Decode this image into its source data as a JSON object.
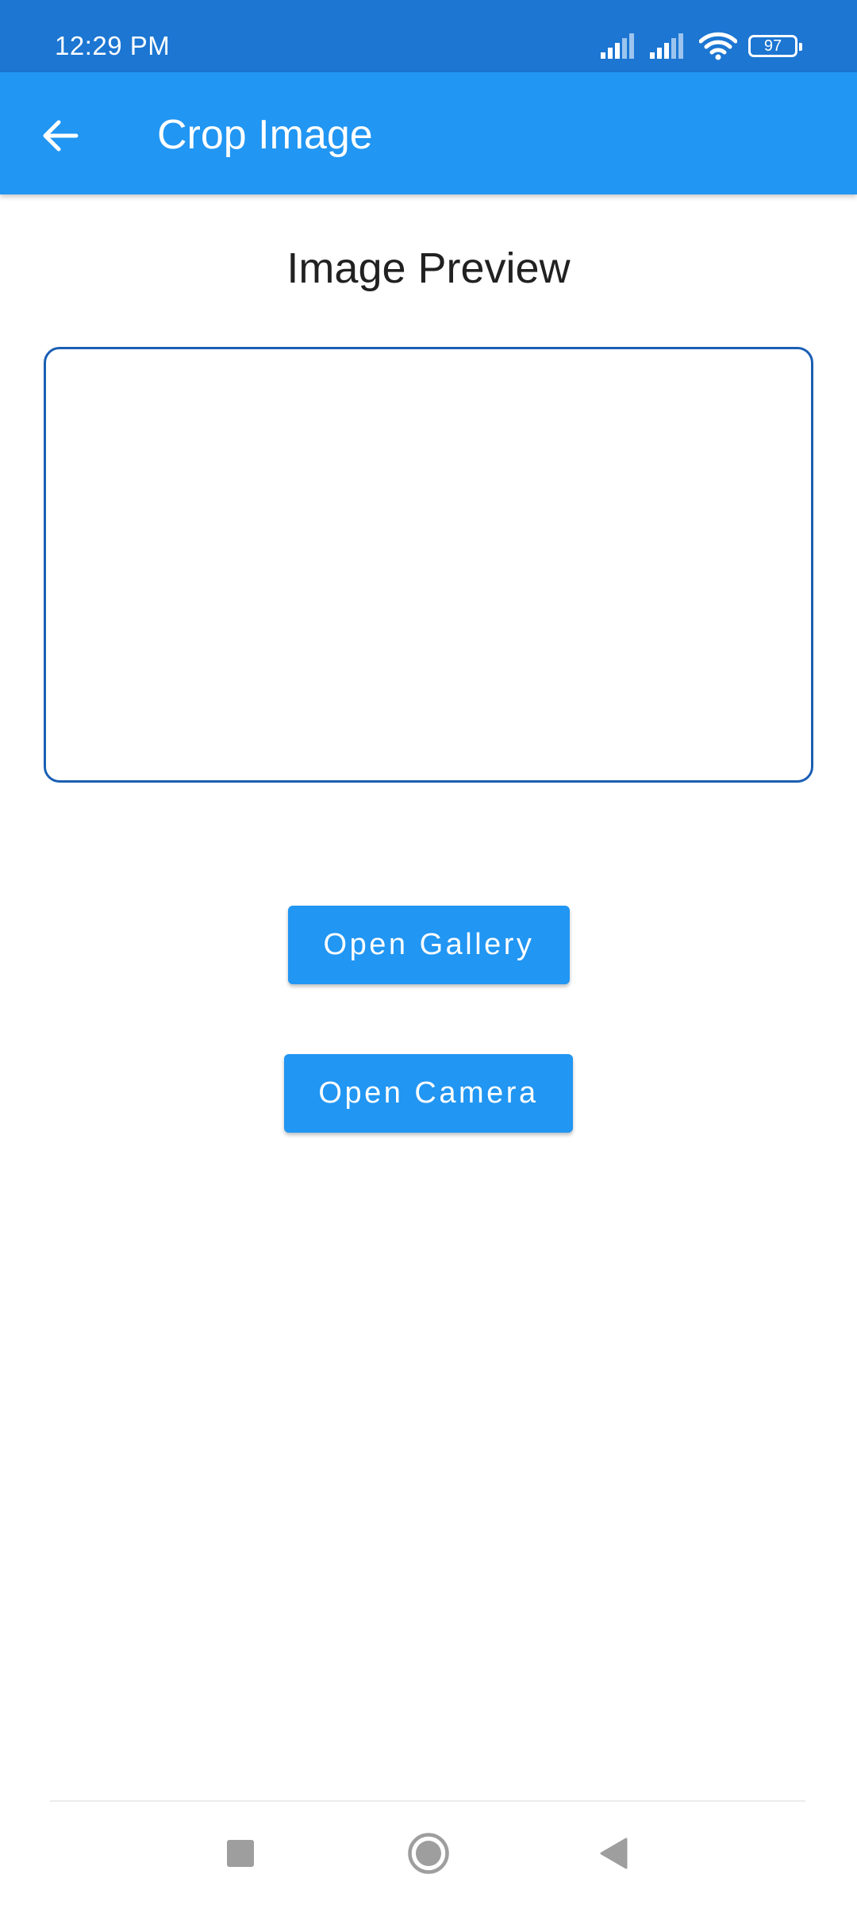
{
  "status_bar": {
    "time": "12:29 PM",
    "battery_level": "97",
    "icons": [
      "signal-icon",
      "signal-icon",
      "wifi-icon",
      "battery-icon"
    ]
  },
  "app_bar": {
    "title": "Crop Image",
    "back_icon": "arrow-back-icon",
    "color": "#2196f3"
  },
  "content": {
    "preview_title": "Image Preview",
    "preview_border_color": "#1a5fb4",
    "buttons": {
      "gallery_label": "Open Gallery",
      "camera_label": "Open Camera",
      "color": "#2196f3"
    }
  },
  "nav_bar": {
    "icons": [
      "recents-square-icon",
      "home-circle-icon",
      "back-triangle-icon"
    ]
  },
  "colors": {
    "status_bar": "#1c76d2",
    "accent": "#2196f3",
    "text_primary": "#212121"
  }
}
